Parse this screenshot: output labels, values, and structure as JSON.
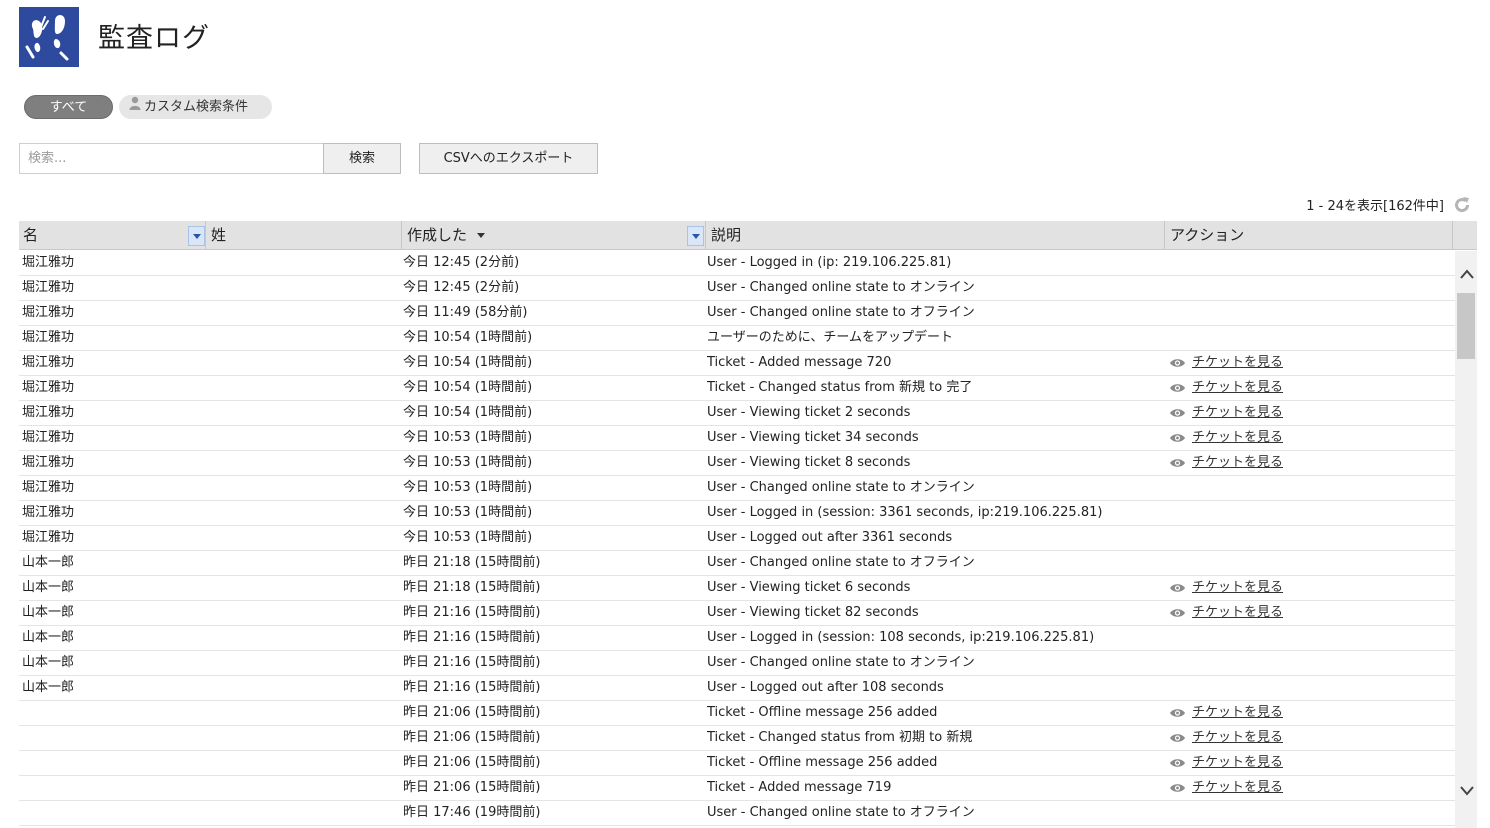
{
  "header": {
    "title": "監査ログ"
  },
  "filters": {
    "all_label": "すべて",
    "custom_label": "カスタム検索条件"
  },
  "search": {
    "placeholder": "検索...",
    "value": "",
    "button_label": "検索"
  },
  "export": {
    "button_label": "CSVへのエクスポート"
  },
  "pagination": {
    "text": "1 - 24を表示[162件中]"
  },
  "table": {
    "headers": {
      "first_name": "名",
      "last_name": "姓",
      "created": "作成した",
      "description": "説明",
      "action": "アクション"
    },
    "action_label": "チケットを見る",
    "rows": [
      {
        "name": "堀江雅功",
        "created": "今日 12:45 (2分前)",
        "desc": "User - Logged in (ip: 219.106.225.81)",
        "action": ""
      },
      {
        "name": "堀江雅功",
        "created": "今日 12:45 (2分前)",
        "desc": "User - Changed online state to オンライン",
        "action": ""
      },
      {
        "name": "堀江雅功",
        "created": "今日 11:49 (58分前)",
        "desc": "User - Changed online state to オフライン",
        "action": ""
      },
      {
        "name": "堀江雅功",
        "created": "今日 10:54 (1時間前)",
        "desc": "ユーザーのために、チームをアップデート",
        "action": ""
      },
      {
        "name": "堀江雅功",
        "created": "今日 10:54 (1時間前)",
        "desc": "Ticket - Added message 720",
        "action": "チケットを見る"
      },
      {
        "name": "堀江雅功",
        "created": "今日 10:54 (1時間前)",
        "desc": "Ticket - Changed status from 新規 to 完了",
        "action": "チケットを見る"
      },
      {
        "name": "堀江雅功",
        "created": "今日 10:54 (1時間前)",
        "desc": "User - Viewing ticket 2 seconds",
        "action": "チケットを見る"
      },
      {
        "name": "堀江雅功",
        "created": "今日 10:53 (1時間前)",
        "desc": "User - Viewing ticket 34 seconds",
        "action": "チケットを見る"
      },
      {
        "name": "堀江雅功",
        "created": "今日 10:53 (1時間前)",
        "desc": "User - Viewing ticket 8 seconds",
        "action": "チケットを見る"
      },
      {
        "name": "堀江雅功",
        "created": "今日 10:53 (1時間前)",
        "desc": "User - Changed online state to オンライン",
        "action": ""
      },
      {
        "name": "堀江雅功",
        "created": "今日 10:53 (1時間前)",
        "desc": "User - Logged in (session: 3361 seconds, ip:219.106.225.81)",
        "action": ""
      },
      {
        "name": "堀江雅功",
        "created": "今日 10:53 (1時間前)",
        "desc": "User - Logged out after 3361 seconds",
        "action": ""
      },
      {
        "name": "山本一郎",
        "created": "昨日 21:18 (15時間前)",
        "desc": "User - Changed online state to オフライン",
        "action": ""
      },
      {
        "name": "山本一郎",
        "created": "昨日 21:18 (15時間前)",
        "desc": "User - Viewing ticket 6 seconds",
        "action": "チケットを見る"
      },
      {
        "name": "山本一郎",
        "created": "昨日 21:16 (15時間前)",
        "desc": "User - Viewing ticket 82 seconds",
        "action": "チケットを見る"
      },
      {
        "name": "山本一郎",
        "created": "昨日 21:16 (15時間前)",
        "desc": "User - Logged in (session: 108 seconds, ip:219.106.225.81)",
        "action": ""
      },
      {
        "name": "山本一郎",
        "created": "昨日 21:16 (15時間前)",
        "desc": "User - Changed online state to オンライン",
        "action": ""
      },
      {
        "name": "山本一郎",
        "created": "昨日 21:16 (15時間前)",
        "desc": "User - Logged out after 108 seconds",
        "action": ""
      },
      {
        "name": "",
        "created": "昨日 21:06 (15時間前)",
        "desc": "Ticket - Offline message 256 added",
        "action": "チケットを見る"
      },
      {
        "name": "",
        "created": "昨日 21:06 (15時間前)",
        "desc": "Ticket - Changed status from 初期 to 新規",
        "action": "チケットを見る"
      },
      {
        "name": "",
        "created": "昨日 21:06 (15時間前)",
        "desc": "Ticket - Offline message 256 added",
        "action": "チケットを見る"
      },
      {
        "name": "",
        "created": "昨日 21:06 (15時間前)",
        "desc": "Ticket - Added message 719",
        "action": "チケットを見る"
      },
      {
        "name": "",
        "created": "昨日 17:46 (19時間前)",
        "desc": "User - Changed online state to オフライン",
        "action": ""
      }
    ]
  },
  "colors": {
    "logo_bg": "#2e4a9e",
    "header_bg": "#e2e2e2",
    "active_filter": "#7f7f7f"
  },
  "icons": {
    "logo": "footprints-icon",
    "action": "eye-icon",
    "refresh": "refresh-icon",
    "custom_filter": "person-icon"
  }
}
